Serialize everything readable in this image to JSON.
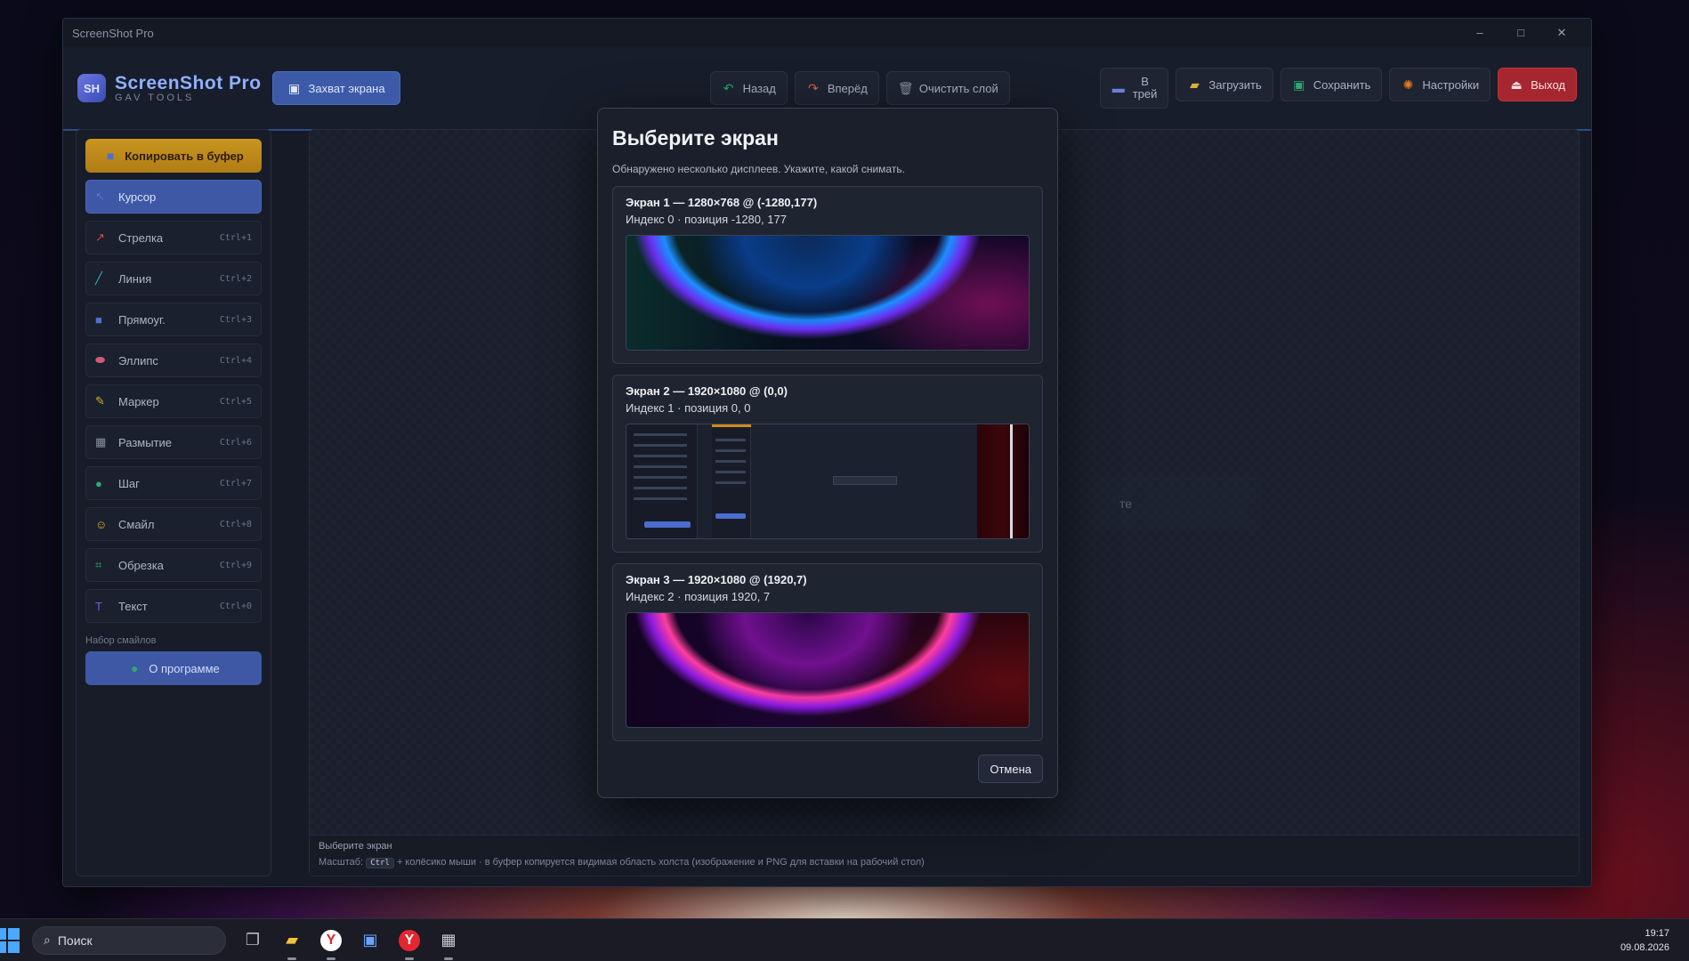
{
  "window": {
    "title": "ScreenShot Pro",
    "controls": [
      "–",
      "□",
      "✕"
    ]
  },
  "app": {
    "logo_badge": "SH",
    "name": "ScreenShot Pro",
    "subtitle": "GAV TOOLS",
    "capture_label": "Захват экрана"
  },
  "toolbar": {
    "back_label": "Назад",
    "forward_label": "Вперёд",
    "clear_layer_label": "Очистить слой",
    "tray_label_1": "В",
    "tray_label_2": "трей",
    "load_label": "Загрузить",
    "save_label": "Сохранить",
    "settings_label": "Настройки",
    "exit_label": "Выход"
  },
  "sidebar": {
    "copy_label": "Копировать в буфер",
    "tools": [
      {
        "label": "Курсор",
        "key": "",
        "icon": "cursor-icon",
        "color": "#5a74d8"
      },
      {
        "label": "Стрелка",
        "key": "Ctrl+1",
        "icon": "arrow-icon",
        "color": "#d44848"
      },
      {
        "label": "Линия",
        "key": "Ctrl+2",
        "icon": "line-icon",
        "color": "#38b0c8"
      },
      {
        "label": "Прямоуг.",
        "key": "Ctrl+3",
        "icon": "rectangle-icon",
        "color": "#4d6fcf"
      },
      {
        "label": "Эллипс",
        "key": "Ctrl+4",
        "icon": "ellipse-icon",
        "color": "#d05a74"
      },
      {
        "label": "Маркер",
        "key": "Ctrl+5",
        "icon": "marker-icon",
        "color": "#d8b232"
      },
      {
        "label": "Размытие",
        "key": "Ctrl+6",
        "icon": "blur-icon",
        "color": "#8a8f9e"
      },
      {
        "label": "Шаг",
        "key": "Ctrl+7",
        "icon": "step-icon",
        "color": "#2fa86e"
      },
      {
        "label": "Смайл",
        "key": "Ctrl+8",
        "icon": "smiley-icon",
        "color": "#e0b632"
      },
      {
        "label": "Обрезка",
        "key": "Ctrl+9",
        "icon": "crop-icon",
        "color": "#2fa86e"
      },
      {
        "label": "Текст",
        "key": "Ctrl+0",
        "icon": "text-icon",
        "color": "#7a5ad8"
      }
    ],
    "smiley_set_label": "Набор смайлов",
    "about_label": "О программе"
  },
  "canvas": {
    "hint_text": "те"
  },
  "status": {
    "line1": "Выберите экран",
    "line2_prefix": "Масштаб:",
    "line2_key": "Ctrl",
    "line2_suffix": "+ колёсико мыши · в буфер копируется видимая область холста (изображение и PNG для вставки на рабочий стол)"
  },
  "dialog": {
    "title": "Выберите экран",
    "description": "Обнаружено несколько дисплеев. Укажите, какой снимать.",
    "screens": [
      {
        "title": "Экран 1 — 1280×768 @ (-1280,177)",
        "info": "Индекс 0 · позиция -1280, 177"
      },
      {
        "title": "Экран 2 — 1920×1080 @ (0,0)",
        "info": "Индекс 1 · позиция 0, 0"
      },
      {
        "title": "Экран 3 — 1920×1080 @ (1920,7)",
        "info": "Индекс 2 · позиция 1920, 7"
      }
    ],
    "cancel_label": "Отмена"
  },
  "taskbar": {
    "search_placeholder": "Поиск",
    "time": "19:17",
    "date": "09.08.2026"
  }
}
